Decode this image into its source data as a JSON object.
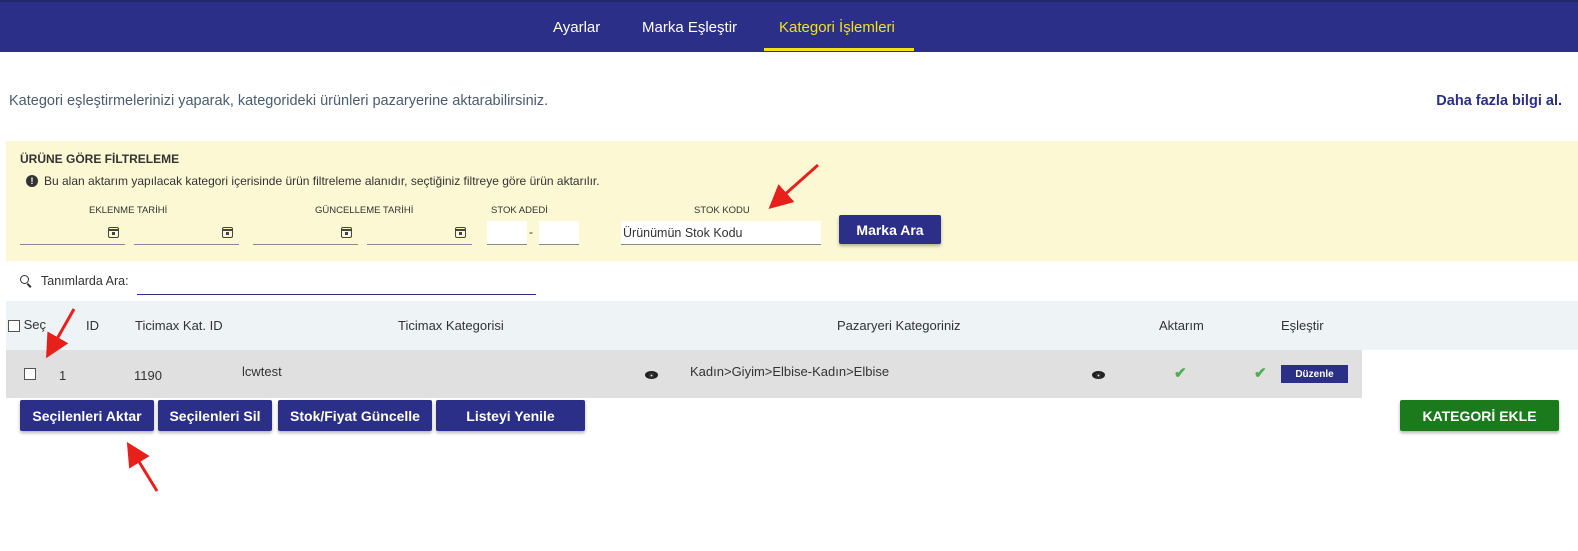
{
  "nav": {
    "items": [
      {
        "label": "Ayarlar"
      },
      {
        "label": "Marka Eşleştir"
      },
      {
        "label": "Kategori İşlemleri",
        "active": true
      }
    ],
    "bg_color": "#2b2f87",
    "active_color": "#f2e21a"
  },
  "intro": {
    "text": "Kategori eşleştirmelerinizi yaparak, kategorideki ürünleri pazaryerine aktarabilirsiniz.",
    "more_link": "Daha fazla bilgi al."
  },
  "filter": {
    "title": "ÜRÜNE GÖRE FİLTRELEME",
    "info_icon": "exclamation-circle-icon",
    "info": "Bu alan aktarım yapılacak kategori içerisinde ürün filtreleme alanıdır, seçtiğiniz filtreye göre ürün aktarılır.",
    "labels": {
      "added_date": "EKLENME TARİHİ",
      "updated_date": "GÜNCELLEME TARİHİ",
      "stock_count": "STOK ADEDİ",
      "stock_code": "STOK KODU"
    },
    "stock_separator": "-",
    "stock_code_value": "Ürünümün Stok Kodu",
    "search_button": "Marka Ara"
  },
  "definition_search": {
    "label": "Tanımlarda Ara:",
    "value": ""
  },
  "table": {
    "headers": {
      "select": "Seç",
      "id": "ID",
      "ticimax_id": "Ticimax Kat. ID",
      "ticimax_category": "Ticimax Kategorisi",
      "market_category": "Pazaryeri Kategoriniz",
      "transfer": "Aktarım",
      "match": "Eşleştir"
    },
    "rows": [
      {
        "selected": false,
        "id": "1",
        "ticimax_id": "1190",
        "ticimax_category": "lcwtest",
        "market_category": "Kadın>Giyim>Elbise-Kadın>Elbise",
        "transfer_ok": true,
        "match_ok": true,
        "edit_label": "Düzenle"
      }
    ]
  },
  "actions": {
    "transfer_selected": "Seçilenleri Aktar",
    "delete_selected": "Seçilenleri Sil",
    "update_stock_price": "Stok/Fiyat Güncelle",
    "refresh_list": "Listeyi Yenile",
    "add_category": "KATEGORİ EKLE",
    "add_color": "#1b7a1b"
  }
}
